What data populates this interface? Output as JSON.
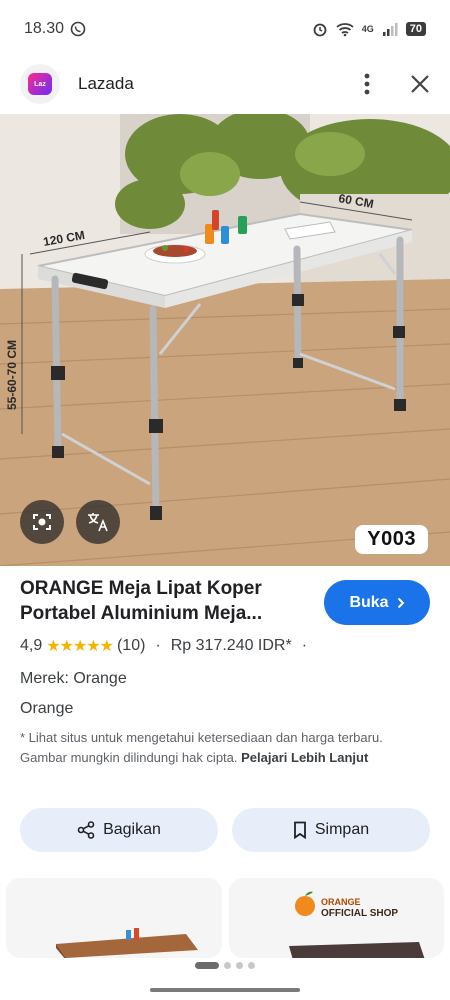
{
  "status_bar": {
    "time": "18.30",
    "battery": "70",
    "network": "4G",
    "icons": [
      "whatsapp-icon",
      "alarm-icon",
      "wifi-icon",
      "signal-icon",
      "battery-icon"
    ]
  },
  "header": {
    "app_name": "Lazada",
    "logo_text": "Laz",
    "icons": [
      "more-vert-icon",
      "close-icon"
    ]
  },
  "image": {
    "label": "Y003",
    "dimension_labels": [
      "120 CM",
      "60 CM",
      "55-60-70 CM"
    ],
    "icons": [
      "lens-icon",
      "translate-icon"
    ]
  },
  "product": {
    "title": "ORANGE Meja Lipat Koper Portabel Aluminium Meja...",
    "open_label": "Buka",
    "rating": "4,9",
    "stars": "★★★★★",
    "review_count": "(10)",
    "price": "Rp 317.240 IDR*",
    "separator": "·",
    "brand": "Merek: Orange",
    "seller": "Orange",
    "disclaimer": "* Lihat situs untuk mengetahui ketersediaan dan harga terbaru. Gambar mungkin dilindungi hak cipta.",
    "learn_more": "Pelajari Lebih Lanjut"
  },
  "actions": {
    "share_label": "Bagikan",
    "save_label": "Simpan"
  },
  "cards": {
    "shop_line1": "ORANGE",
    "shop_line2": "OFFICIAL SHOP"
  },
  "colors": {
    "accent": "#1a73e8",
    "star": "#f4b400",
    "chip_bg": "#e8eef9"
  }
}
